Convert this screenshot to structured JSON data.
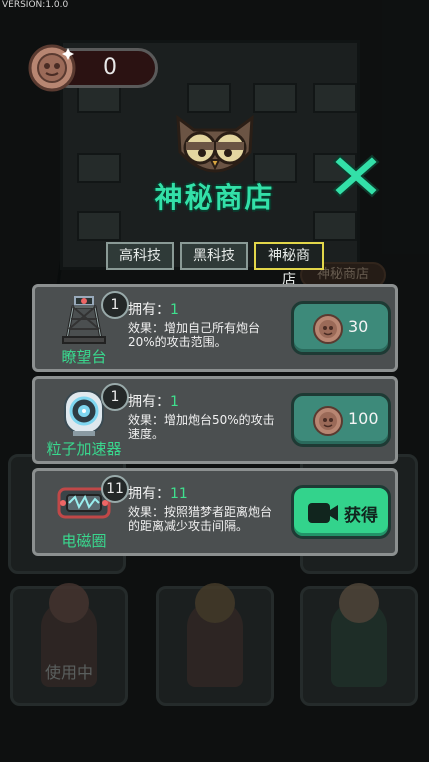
{
  "version_text": "VERSION:1.0.0",
  "coins": {
    "icon": "coin-icon",
    "value": "0"
  },
  "title": "神秘商店",
  "colors": {
    "accent": "#33e0a8",
    "active_tab_border": "#e2d64a",
    "owned_green": "#3fe08e"
  },
  "tabs": [
    {
      "label": "高科技",
      "active": false
    },
    {
      "label": "黑科技",
      "active": false
    },
    {
      "label": "神秘商店",
      "active": true
    }
  ],
  "items": [
    {
      "name": "瞭望台",
      "icon": "watchtower-icon",
      "badge": "1",
      "owned_label": "拥有：",
      "owned_value": "1",
      "effect": "效果：增加自己所有炮台20%的攻击范围。",
      "action": {
        "type": "coin",
        "price": "30"
      }
    },
    {
      "name": "粒子加速器",
      "icon": "particle-accelerator-icon",
      "badge": "1",
      "owned_label": "拥有：",
      "owned_value": "1",
      "effect": "效果：增加炮台50%的攻击速度。",
      "action": {
        "type": "coin",
        "price": "100"
      }
    },
    {
      "name": "电磁圈",
      "icon": "electromagnetic-coil-icon",
      "badge": "11",
      "owned_label": "拥有：",
      "owned_value": "11",
      "effect": "效果：按照猎梦者距离炮台的距离减少攻击间隔。",
      "action": {
        "type": "video",
        "label": "获得"
      }
    }
  ],
  "background": {
    "sign_text": "神秘商店",
    "in_use_label": "使用中"
  }
}
